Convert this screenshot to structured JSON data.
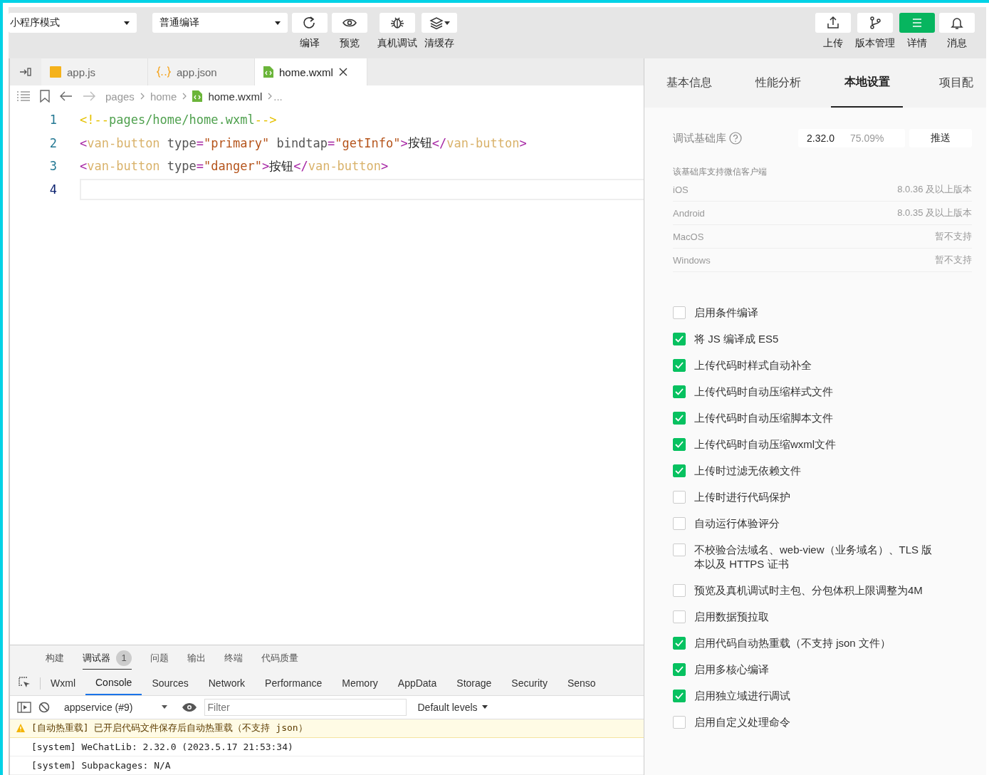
{
  "toolbar": {
    "mode_select": "小程序模式",
    "compile_select": "普通编译",
    "left_buttons": [
      {
        "label": "编译"
      },
      {
        "label": "预览"
      },
      {
        "label": "真机调试"
      },
      {
        "label": "清缓存"
      }
    ],
    "right_buttons": [
      {
        "label": "上传",
        "active": false
      },
      {
        "label": "版本管理",
        "active": false
      },
      {
        "label": "详情",
        "active": true
      },
      {
        "label": "消息",
        "active": false
      }
    ]
  },
  "editor_tabs": [
    {
      "label": "app.js",
      "selected": false
    },
    {
      "label": "app.json",
      "selected": false
    },
    {
      "label": "home.wxml",
      "selected": true
    }
  ],
  "breadcrumb": {
    "parts": [
      "pages",
      "home"
    ],
    "file": "home.wxml",
    "more": "..."
  },
  "code_lines": [
    {
      "number": "1",
      "current": false,
      "tokens": [
        {
          "kind": "cmark",
          "t": "<!--"
        },
        {
          "kind": "comment",
          "t": "pages/home/home.wxml"
        },
        {
          "kind": "cmark",
          "t": "-->"
        }
      ]
    },
    {
      "number": "2",
      "current": false,
      "tokens": [
        {
          "kind": "punct",
          "t": "<"
        },
        {
          "kind": "tag",
          "t": "van-button"
        },
        {
          "kind": "attr",
          "t": " type"
        },
        {
          "kind": "punct",
          "t": "="
        },
        {
          "kind": "str",
          "t": "\"primary\""
        },
        {
          "kind": "attr",
          "t": " bindtap"
        },
        {
          "kind": "punct",
          "t": "="
        },
        {
          "kind": "str",
          "t": "\"getInfo\""
        },
        {
          "kind": "punct",
          "t": ">"
        },
        {
          "kind": "text",
          "t": "按钮"
        },
        {
          "kind": "punct",
          "t": "</"
        },
        {
          "kind": "tag",
          "t": "van-button"
        },
        {
          "kind": "punct",
          "t": ">"
        }
      ]
    },
    {
      "number": "3",
      "current": false,
      "tokens": [
        {
          "kind": "punct",
          "t": "<"
        },
        {
          "kind": "tag",
          "t": "van-button"
        },
        {
          "kind": "attr",
          "t": " type"
        },
        {
          "kind": "punct",
          "t": "="
        },
        {
          "kind": "str",
          "t": "\"danger\""
        },
        {
          "kind": "punct",
          "t": ">"
        },
        {
          "kind": "text",
          "t": "按钮"
        },
        {
          "kind": "punct",
          "t": "</"
        },
        {
          "kind": "tag",
          "t": "van-button"
        },
        {
          "kind": "punct",
          "t": ">"
        }
      ]
    },
    {
      "number": "4",
      "current": true
    }
  ],
  "bottom_tabs": [
    {
      "label": "构建",
      "selected": false
    },
    {
      "label": "调试器",
      "selected": true,
      "badge": "1"
    },
    {
      "label": "问题",
      "selected": false
    },
    {
      "label": "输出",
      "selected": false
    },
    {
      "label": "终端",
      "selected": false
    },
    {
      "label": "代码质量",
      "selected": false
    }
  ],
  "devtools_tabs": [
    {
      "label": "Wxml",
      "selected": false
    },
    {
      "label": "Console",
      "selected": true
    },
    {
      "label": "Sources",
      "selected": false
    },
    {
      "label": "Network",
      "selected": false
    },
    {
      "label": "Performance",
      "selected": false
    },
    {
      "label": "Memory",
      "selected": false
    },
    {
      "label": "AppData",
      "selected": false
    },
    {
      "label": "Storage",
      "selected": false
    },
    {
      "label": "Security",
      "selected": false
    },
    {
      "label": "Senso",
      "selected": false
    }
  ],
  "console_toolbar": {
    "context": "appservice (#9)",
    "filter_placeholder": "Filter",
    "levels": "Default levels"
  },
  "console_lines": [
    {
      "kind": "warning",
      "text": "[自动热重载] 已开启代码文件保存后自动热重载（不支持 json）"
    },
    {
      "kind": "log",
      "text": "[system] WeChatLib: 2.32.0 (2023.5.17 21:53:34)"
    },
    {
      "kind": "log",
      "text": "[system] Subpackages: N/A"
    }
  ],
  "panel_tabs": [
    {
      "label": "基本信息",
      "selected": false
    },
    {
      "label": "性能分析",
      "selected": false
    },
    {
      "label": "本地设置",
      "selected": true
    },
    {
      "label": "项目配",
      "selected": false
    }
  ],
  "debug_lib": {
    "label": "调试基础库",
    "version": "2.32.0",
    "share": "75.09%",
    "push_button": "推送"
  },
  "support": {
    "title": "该基础库支持微信客户端",
    "rows": [
      {
        "platform": "iOS",
        "value": "8.0.36 及以上版本"
      },
      {
        "platform": "Android",
        "value": "8.0.35 及以上版本"
      },
      {
        "platform": "MacOS",
        "value": "暂不支持"
      },
      {
        "platform": "Windows",
        "value": "暂不支持"
      }
    ]
  },
  "settings": [
    {
      "label": "启用条件编译",
      "checked": false
    },
    {
      "label": "将 JS 编译成 ES5",
      "checked": true
    },
    {
      "label": "上传代码时样式自动补全",
      "checked": true
    },
    {
      "label": "上传代码时自动压缩样式文件",
      "checked": true
    },
    {
      "label": "上传代码时自动压缩脚本文件",
      "checked": true
    },
    {
      "label": "上传代码时自动压缩wxml文件",
      "checked": true
    },
    {
      "label": "上传时过滤无依赖文件",
      "checked": true
    },
    {
      "label": "上传时进行代码保护",
      "checked": false
    },
    {
      "label": "自动运行体验评分",
      "checked": false
    },
    {
      "label": "不校验合法域名、web-view（业务域名）、TLS 版本以及 HTTPS 证书",
      "checked": false
    },
    {
      "label": "预览及真机调试时主包、分包体积上限调整为4M",
      "checked": false
    },
    {
      "label": "启用数据预拉取",
      "checked": false
    },
    {
      "label": "启用代码自动热重载（不支持 json 文件）",
      "checked": true
    },
    {
      "label": "启用多核心编译",
      "checked": true
    },
    {
      "label": "启用独立域进行调试",
      "checked": true
    },
    {
      "label": "启用自定义处理命令",
      "checked": false
    }
  ]
}
